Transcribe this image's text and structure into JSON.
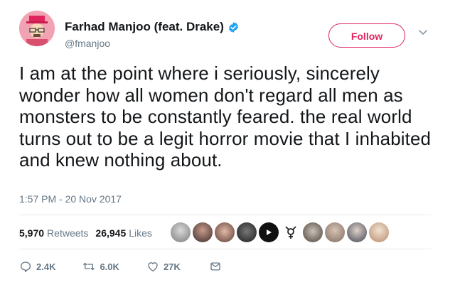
{
  "tweet": {
    "display_name": "Farhad Manjoo (feat. Drake)",
    "handle": "@fmanjoo",
    "text": "I am at the point where i seriously, sincerely wonder how all women don't regard all men as monsters to be constantly feared. the real world turns out to be a legit horror movie that I inhabited and knew nothing about.",
    "timestamp": "1:57 PM - 20 Nov 2017"
  },
  "follow_button": {
    "label": "Follow"
  },
  "stats": {
    "retweets_count": "5,970",
    "retweets_label": "Retweets",
    "likes_count": "26,945",
    "likes_label": "Likes"
  },
  "actions": {
    "reply_count": "2.4K",
    "retweet_count": "6.0K",
    "like_count": "27K"
  },
  "colors": {
    "accent": "#e0245e",
    "verified": "#1da1f2",
    "muted_text": "#657786",
    "divider": "#e6ecf0"
  },
  "icons": [
    "verified-badge-icon",
    "chevron-down-icon",
    "reply-icon",
    "retweet-icon",
    "like-icon",
    "message-icon"
  ]
}
